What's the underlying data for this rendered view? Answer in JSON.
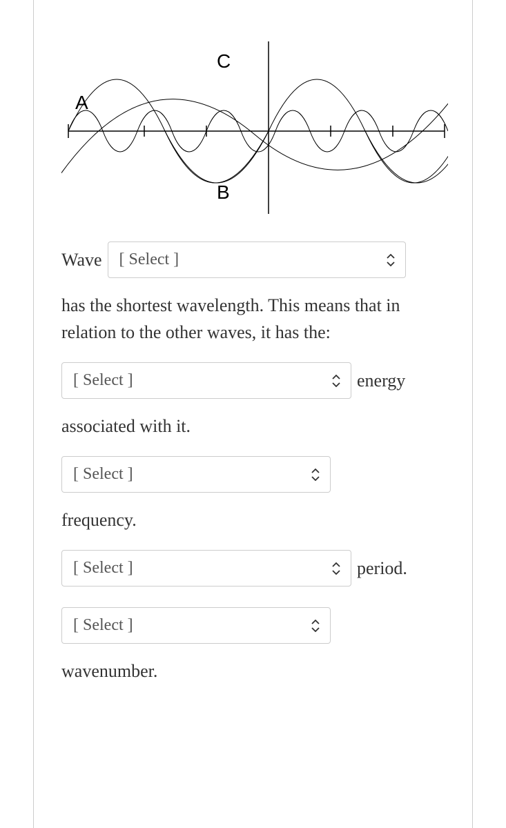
{
  "diagram": {
    "labels": {
      "A": "A",
      "B": "B",
      "C": "C"
    }
  },
  "question": {
    "line1_prefix": "Wave",
    "select1_placeholder": "[ Select ]",
    "text_after_wave": "has the shortest wavelength. This means that in relation to the other waves, it has the:",
    "select2_placeholder": "[ Select ]",
    "text_energy": "energy",
    "text_associated": "associated with it.",
    "select3_placeholder": "[ Select ]",
    "text_frequency": "frequency.",
    "select4_placeholder": "[ Select ]",
    "text_period": "period.",
    "select5_placeholder": "[ Select ]",
    "text_wavenumber": "wavenumber."
  }
}
